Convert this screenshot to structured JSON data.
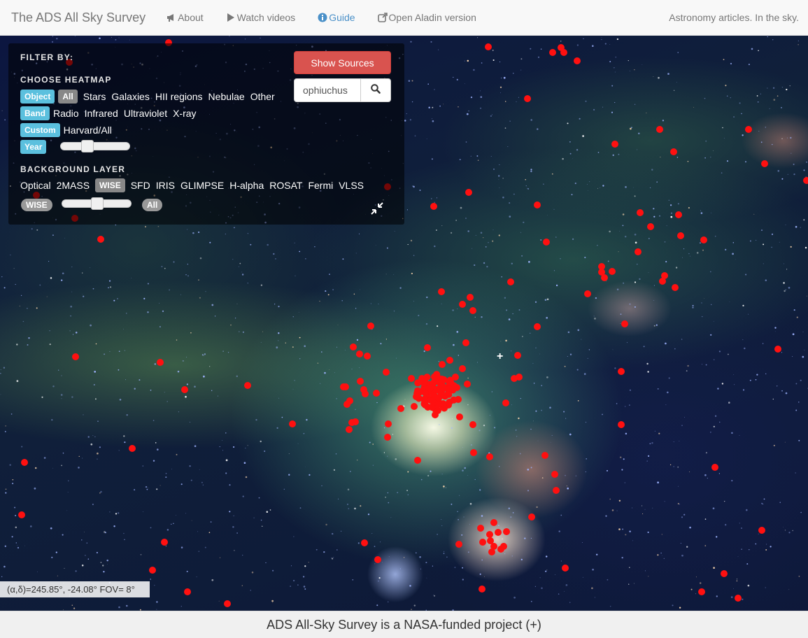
{
  "navbar": {
    "brand": "The ADS All Sky Survey",
    "items": [
      {
        "label": "About",
        "icon": "bullhorn-icon"
      },
      {
        "label": "Watch videos",
        "icon": "play-icon"
      },
      {
        "label": "Guide",
        "icon": "info-icon",
        "active": true
      },
      {
        "label": "Open Aladin version",
        "icon": "external-link-icon"
      }
    ],
    "tagline": "Astronomy articles. In the sky."
  },
  "filter": {
    "title": "FILTER BY:",
    "heatmap_title": "CHOOSE HEATMAP",
    "object_label": "Object",
    "object_options": [
      "All",
      "Stars",
      "Galaxies",
      "HII regions",
      "Nebulae",
      "Other"
    ],
    "object_selected": "All",
    "band_label": "Band",
    "band_options": [
      "Radio",
      "Infrared",
      "Ultraviolet",
      "X-ray"
    ],
    "custom_label": "Custom",
    "custom_value": "Harvard/All",
    "year_label": "Year",
    "year_slider_fraction": 0.35,
    "background_title": "BACKGROUND LAYER",
    "background_options": [
      "Optical",
      "2MASS",
      "WISE",
      "SFD",
      "IRIS",
      "GLIMPSE",
      "H-alpha",
      "ROSAT",
      "Fermi",
      "VLSS"
    ],
    "background_selected": "WISE",
    "opacity_left_label": "WISE",
    "opacity_right_label": "All",
    "opacity_fraction": 0.5
  },
  "actions": {
    "show_sources_label": "Show Sources",
    "search_value": "ophiuchus"
  },
  "status": {
    "coords": "(α,δ)=245.85°, -24.08° FOV= 8°"
  },
  "footer": {
    "text": "ADS All-Sky Survey is a NASA-funded project (+)"
  },
  "colors": {
    "accent_info": "#5bc0de",
    "danger": "#d9534f",
    "source_dot": "#ff1010",
    "nav_active": "#4a90c8"
  }
}
